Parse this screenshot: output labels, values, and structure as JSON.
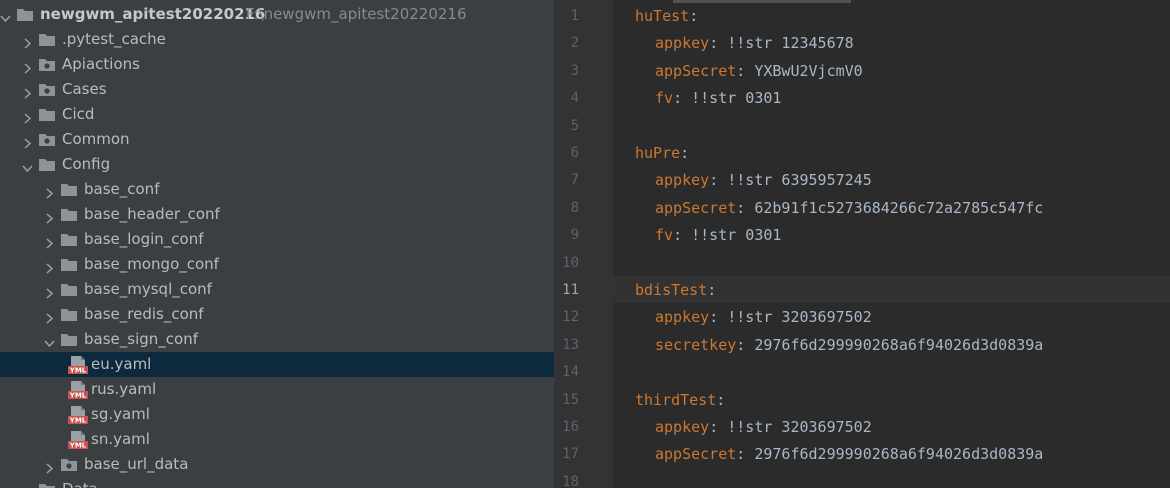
{
  "project": {
    "name": "newgwm_apitest20220216",
    "path": "F:\\newgwm_apitest20220216"
  },
  "tree": [
    {
      "label": "newgwm_apitest20220216",
      "kind": "project",
      "depth": 0,
      "expanded": true
    },
    {
      "label": ".pytest_cache",
      "kind": "folder",
      "depth": 1,
      "expanded": false
    },
    {
      "label": "Apiactions",
      "kind": "package",
      "depth": 1,
      "expanded": false
    },
    {
      "label": "Cases",
      "kind": "package",
      "depth": 1,
      "expanded": false
    },
    {
      "label": "Cicd",
      "kind": "folder",
      "depth": 1,
      "expanded": false
    },
    {
      "label": "Common",
      "kind": "package",
      "depth": 1,
      "expanded": false
    },
    {
      "label": "Config",
      "kind": "folder",
      "depth": 1,
      "expanded": true
    },
    {
      "label": "base_conf",
      "kind": "folder",
      "depth": 2,
      "expanded": false
    },
    {
      "label": "base_header_conf",
      "kind": "folder",
      "depth": 2,
      "expanded": false
    },
    {
      "label": "base_login_conf",
      "kind": "folder",
      "depth": 2,
      "expanded": false
    },
    {
      "label": "base_mongo_conf",
      "kind": "folder",
      "depth": 2,
      "expanded": false
    },
    {
      "label": "base_mysql_conf",
      "kind": "folder",
      "depth": 2,
      "expanded": false
    },
    {
      "label": "base_redis_conf",
      "kind": "folder",
      "depth": 2,
      "expanded": false
    },
    {
      "label": "base_sign_conf",
      "kind": "folder",
      "depth": 2,
      "expanded": true
    },
    {
      "label": "eu.yaml",
      "kind": "yaml",
      "depth": 3,
      "selected": true
    },
    {
      "label": "rus.yaml",
      "kind": "yaml",
      "depth": 3
    },
    {
      "label": "sg.yaml",
      "kind": "yaml",
      "depth": 3
    },
    {
      "label": "sn.yaml",
      "kind": "yaml",
      "depth": 3
    },
    {
      "label": "base_url_data",
      "kind": "package",
      "depth": 2,
      "expanded": false
    },
    {
      "label": "Data",
      "kind": "folder",
      "depth": 1,
      "expanded": false
    }
  ],
  "yaml_icon_text": "YML",
  "current_line": 11,
  "editor_lines": [
    {
      "n": "1",
      "key": "huTest",
      "sep": ":",
      "value": "",
      "indent": false,
      "fold": "open"
    },
    {
      "n": "2",
      "key": "appkey",
      "sep": ": ",
      "value": "!!str 12345678",
      "indent": true
    },
    {
      "n": "3",
      "key": "appSecret",
      "sep": ": ",
      "value": "YXBwU2VjcmV0",
      "indent": true
    },
    {
      "n": "4",
      "key": "fv",
      "sep": ": ",
      "value": "!!str 0301",
      "indent": true,
      "fold": "close"
    },
    {
      "n": "5",
      "key": "",
      "sep": "",
      "value": "",
      "indent": false
    },
    {
      "n": "6",
      "key": "huPre",
      "sep": ":",
      "value": "",
      "indent": false,
      "fold": "open"
    },
    {
      "n": "7",
      "key": "appkey",
      "sep": ": ",
      "value": "!!str 6395957245",
      "indent": true
    },
    {
      "n": "8",
      "key": "appSecret",
      "sep": ": ",
      "value": "62b91f1c5273684266c72a2785c547fc",
      "indent": true
    },
    {
      "n": "9",
      "key": "fv",
      "sep": ": ",
      "value": "!!str 0301",
      "indent": true,
      "fold": "close"
    },
    {
      "n": "10",
      "key": "",
      "sep": "",
      "value": "",
      "indent": false
    },
    {
      "n": "11",
      "key": "bdisTest",
      "sep": ":",
      "value": "",
      "indent": false,
      "fold": "open"
    },
    {
      "n": "12",
      "key": "appkey",
      "sep": ": ",
      "value": "!!str 3203697502",
      "indent": true
    },
    {
      "n": "13",
      "key": "secretkey",
      "sep": ": ",
      "value": "2976f6d299990268a6f94026d3d0839a",
      "indent": true,
      "fold": "close"
    },
    {
      "n": "14",
      "key": "",
      "sep": "",
      "value": "",
      "indent": false
    },
    {
      "n": "15",
      "key": "thirdTest",
      "sep": ":",
      "value": "",
      "indent": false,
      "fold": "open"
    },
    {
      "n": "16",
      "key": "appkey",
      "sep": ": ",
      "value": "!!str 3203697502",
      "indent": true
    },
    {
      "n": "17",
      "key": "appSecret",
      "sep": ": ",
      "value": "2976f6d299990268a6f94026d3d0839a",
      "indent": true,
      "fold": "close"
    },
    {
      "n": "18",
      "key": "",
      "sep": "",
      "value": "",
      "indent": false
    }
  ],
  "colors": {
    "sidebar_bg": "#3c3f41",
    "selection_bg": "#0d293e",
    "editor_bg": "#2b2b2b",
    "gutter_bg": "#313335",
    "yaml_key": "#cc7832",
    "yaml_value": "#a9b7c6",
    "folder_icon": "#8c9399",
    "yaml_icon_red": "#c75450"
  }
}
